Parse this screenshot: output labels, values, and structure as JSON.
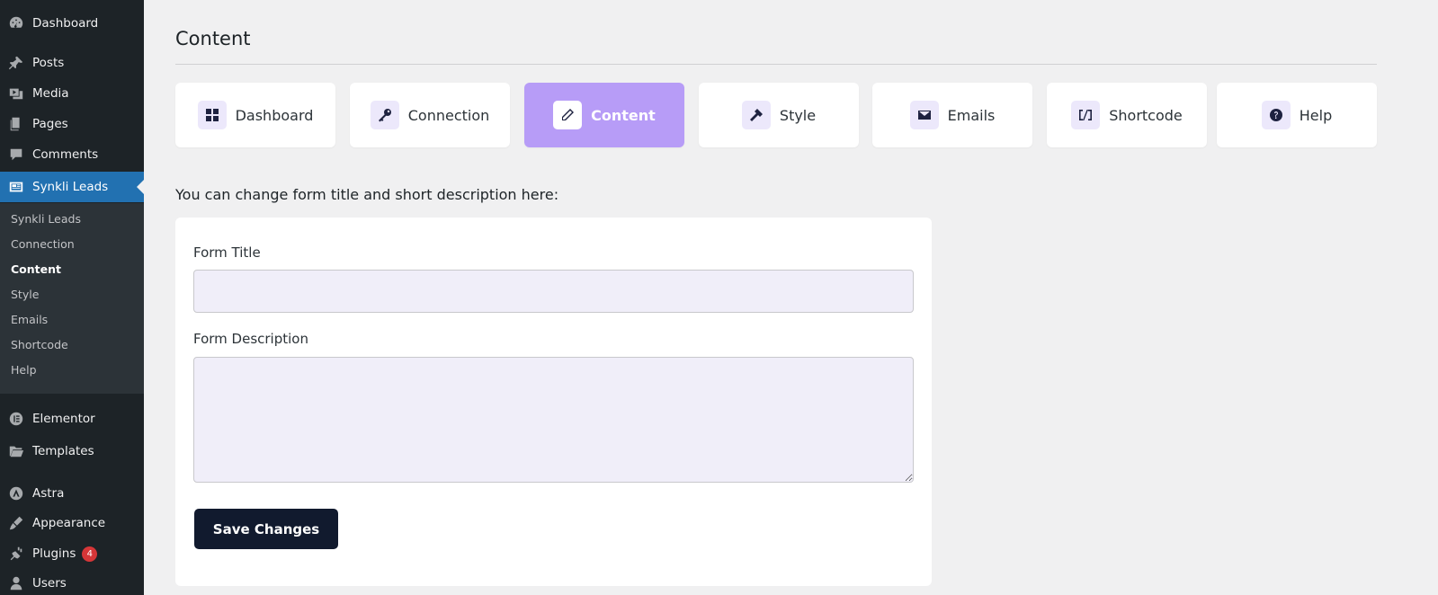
{
  "sidebar": {
    "items": [
      {
        "label": "Dashboard",
        "icon": "dashboard-icon"
      },
      {
        "label": "Posts",
        "icon": "pin-icon"
      },
      {
        "label": "Media",
        "icon": "media-icon"
      },
      {
        "label": "Pages",
        "icon": "pages-icon"
      },
      {
        "label": "Comments",
        "icon": "comment-icon"
      },
      {
        "label": "Synkli Leads",
        "icon": "leads-icon"
      },
      {
        "label": "Elementor",
        "icon": "elementor-icon"
      },
      {
        "label": "Templates",
        "icon": "folder-icon"
      },
      {
        "label": "Astra",
        "icon": "astra-icon"
      },
      {
        "label": "Appearance",
        "icon": "brush-icon"
      },
      {
        "label": "Plugins",
        "icon": "plugin-icon",
        "badge": "4"
      },
      {
        "label": "Users",
        "icon": "user-icon"
      }
    ],
    "submenu": [
      "Synkli Leads",
      "Connection",
      "Content",
      "Style",
      "Emails",
      "Shortcode",
      "Help"
    ],
    "current_submenu": "Content"
  },
  "header": {
    "title": "Content"
  },
  "tabs": [
    {
      "label": "Dashboard",
      "icon": "grid-icon"
    },
    {
      "label": "Connection",
      "icon": "key-icon"
    },
    {
      "label": "Content",
      "icon": "pencil-icon",
      "active": true
    },
    {
      "label": "Style",
      "icon": "hammer-icon"
    },
    {
      "label": "Emails",
      "icon": "envelope-icon"
    },
    {
      "label": "Shortcode",
      "icon": "shortcode-icon"
    },
    {
      "label": "Help",
      "icon": "question-icon"
    }
  ],
  "intro": "You can change form title and short description here:",
  "form": {
    "title_label": "Form Title",
    "title_value": "",
    "description_label": "Form Description",
    "description_value": "",
    "save_label": "Save Changes"
  },
  "colors": {
    "sidebar_bg": "#1d2327",
    "sidebar_active": "#2271b1",
    "tab_active": "#b79cf7",
    "button": "#111a2e",
    "badge": "#d63638"
  }
}
